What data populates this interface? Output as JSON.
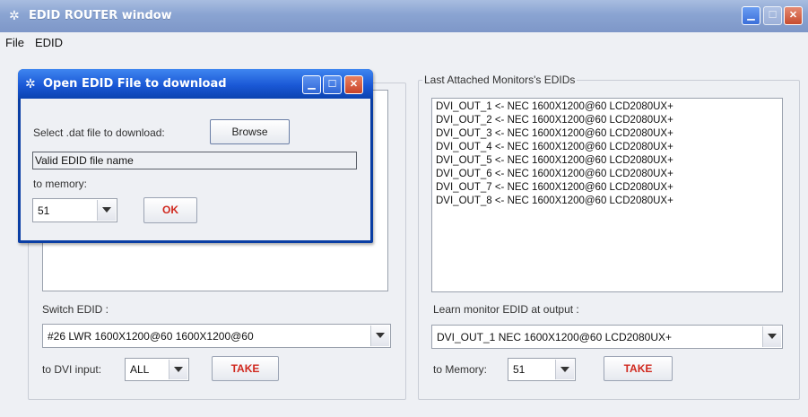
{
  "window": {
    "title": "EDID ROUTER window"
  },
  "menu": {
    "file": "File",
    "edid": "EDID"
  },
  "left_panel": {
    "switch_label": "Switch EDID :",
    "switch_value": "#26 LWR 1600X1200@60 1600X1200@60",
    "dvi_input_label": "to DVI input:",
    "dvi_input_value": "ALL",
    "take_label": "TAKE"
  },
  "right_panel": {
    "legend": "Last Attached Monitors's EDIDs",
    "monitors": [
      "DVI_OUT_1 <-  NEC 1600X1200@60 LCD2080UX+",
      "DVI_OUT_2 <-  NEC 1600X1200@60 LCD2080UX+",
      "DVI_OUT_3 <-  NEC 1600X1200@60 LCD2080UX+",
      "DVI_OUT_4 <-  NEC 1600X1200@60 LCD2080UX+",
      "DVI_OUT_5 <-  NEC 1600X1200@60 LCD2080UX+",
      "DVI_OUT_6 <-  NEC 1600X1200@60 LCD2080UX+",
      "DVI_OUT_7 <-  NEC 1600X1200@60 LCD2080UX+",
      "DVI_OUT_8 <-  NEC 1600X1200@60 LCD2080UX+"
    ],
    "learn_label": "Learn monitor EDID at output :",
    "learn_value": "DVI_OUT_1  NEC 1600X1200@60 LCD2080UX+",
    "memory_label": "to Memory:",
    "memory_value": "51",
    "take_label": "TAKE"
  },
  "dialog": {
    "title": "Open EDID File to download",
    "select_label": "Select .dat file to download:",
    "browse_label": "Browse",
    "filename_value": "Valid EDID file name",
    "memory_label": "to memory:",
    "memory_value": "51",
    "ok_label": "OK"
  },
  "colors": {
    "accent_red": "#d0281e",
    "title_blue": "#1a58d6"
  }
}
